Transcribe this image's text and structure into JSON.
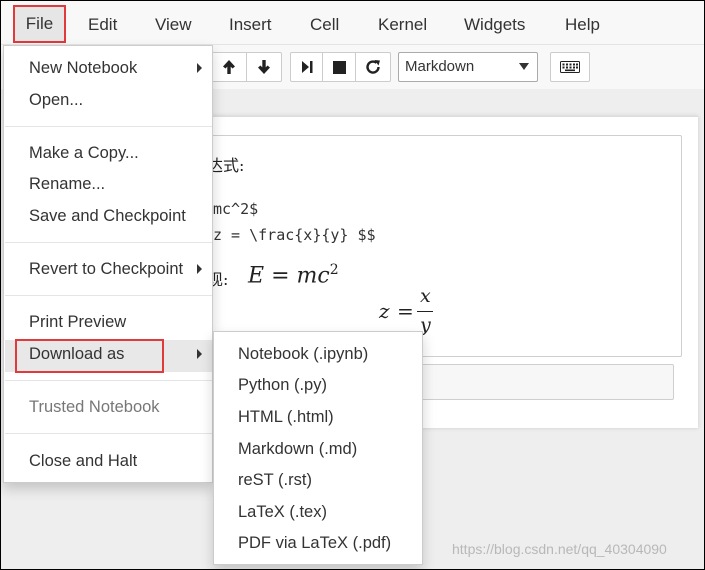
{
  "menubar": {
    "items": [
      "File",
      "Edit",
      "View",
      "Insert",
      "Cell",
      "Kernel",
      "Widgets",
      "Help"
    ]
  },
  "toolbar": {
    "buttons": [
      "arrow-up-icon",
      "arrow-down-icon",
      "run-icon",
      "stop-icon",
      "restart-icon",
      "keyboard-icon"
    ],
    "cell_type": "Markdown"
  },
  "cell": {
    "line1": "达式:",
    "line2": "mc^2$",
    "line3": "z = \\frac{x}{y} $$",
    "line4_prefix": "现:",
    "formula1_lhs": "E",
    "formula1_eq": "=",
    "formula1_rhs": "mc",
    "formula1_exp": "2",
    "formula2_lhs": "z",
    "formula2_eq": "=",
    "formula2_num": "x",
    "formula2_den": "y"
  },
  "file_menu": {
    "items": [
      {
        "label": "New Notebook",
        "submenu": true
      },
      {
        "label": "Open..."
      },
      {
        "label": "Make a Copy..."
      },
      {
        "label": "Rename..."
      },
      {
        "label": "Save and Checkpoint"
      },
      {
        "label": "Revert to Checkpoint",
        "submenu": true
      },
      {
        "label": "Print Preview"
      },
      {
        "label": "Download as",
        "submenu": true,
        "highlighted": true
      },
      {
        "label": "Trusted Notebook",
        "disabled": true
      },
      {
        "label": "Close and Halt"
      }
    ]
  },
  "download_submenu": {
    "items": [
      "Notebook (.ipynb)",
      "Python (.py)",
      "HTML (.html)",
      "Markdown (.md)",
      "reST (.rst)",
      "LaTeX (.tex)",
      "PDF via LaTeX (.pdf)"
    ]
  },
  "watermark": "https://blog.csdn.net/qq_40304090",
  "colors": {
    "highlight_border": "#e03a3a",
    "menubar_bg": "#f8f8f8"
  }
}
